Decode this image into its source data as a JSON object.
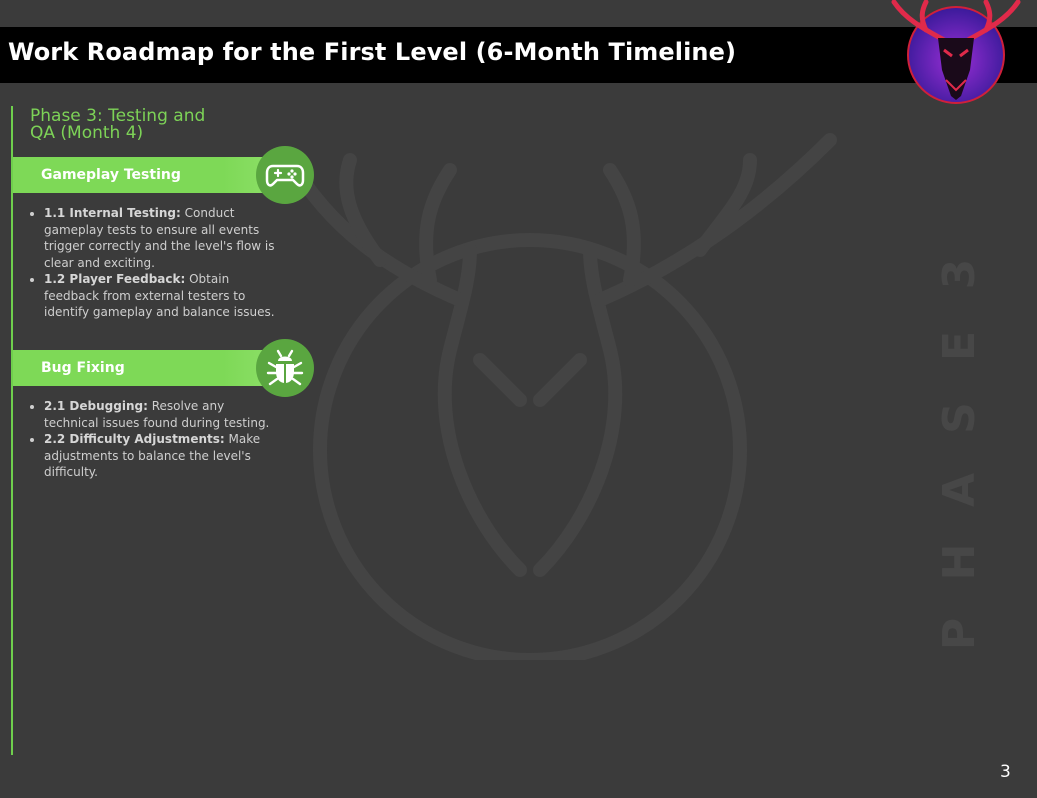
{
  "header": {
    "title": "Work Roadmap for the First Level (6-Month Timeline)",
    "logo_icon": "demon-deer-skull-icon"
  },
  "watermark": {
    "icon": "deer-skull-watermark-icon",
    "vertical_text": [
      "P",
      "H",
      "A",
      "S",
      "E",
      "3"
    ]
  },
  "phase": {
    "title_line1": "Phase 3: Testing and",
    "title_line2": "QA (Month 4)"
  },
  "sections": [
    {
      "label": "Gameplay Testing",
      "icon": "gamepad-icon",
      "items": [
        {
          "label": "1.1 Internal Testing:",
          "text": " Conduct gameplay tests to ensure all events trigger correctly and the level's flow is clear and exciting."
        },
        {
          "label": "1.2 Player Feedback:",
          "text": " Obtain feedback from external testers to identify gameplay and balance issues."
        }
      ]
    },
    {
      "label": "Bug Fixing",
      "icon": "bug-icon",
      "items": [
        {
          "label": "2.1 Debugging:",
          "text": " Resolve any technical issues found during testing."
        },
        {
          "label": "2.2 Difficulty Adjustments:",
          "text": " Make adjustments to balance the level's difficulty."
        }
      ]
    }
  ],
  "footer": {
    "page_number": "3"
  },
  "colors": {
    "accent_green": "#7ed957",
    "icon_green": "#5aa640",
    "background": "#3b3b3b",
    "titlebar": "#000000"
  }
}
